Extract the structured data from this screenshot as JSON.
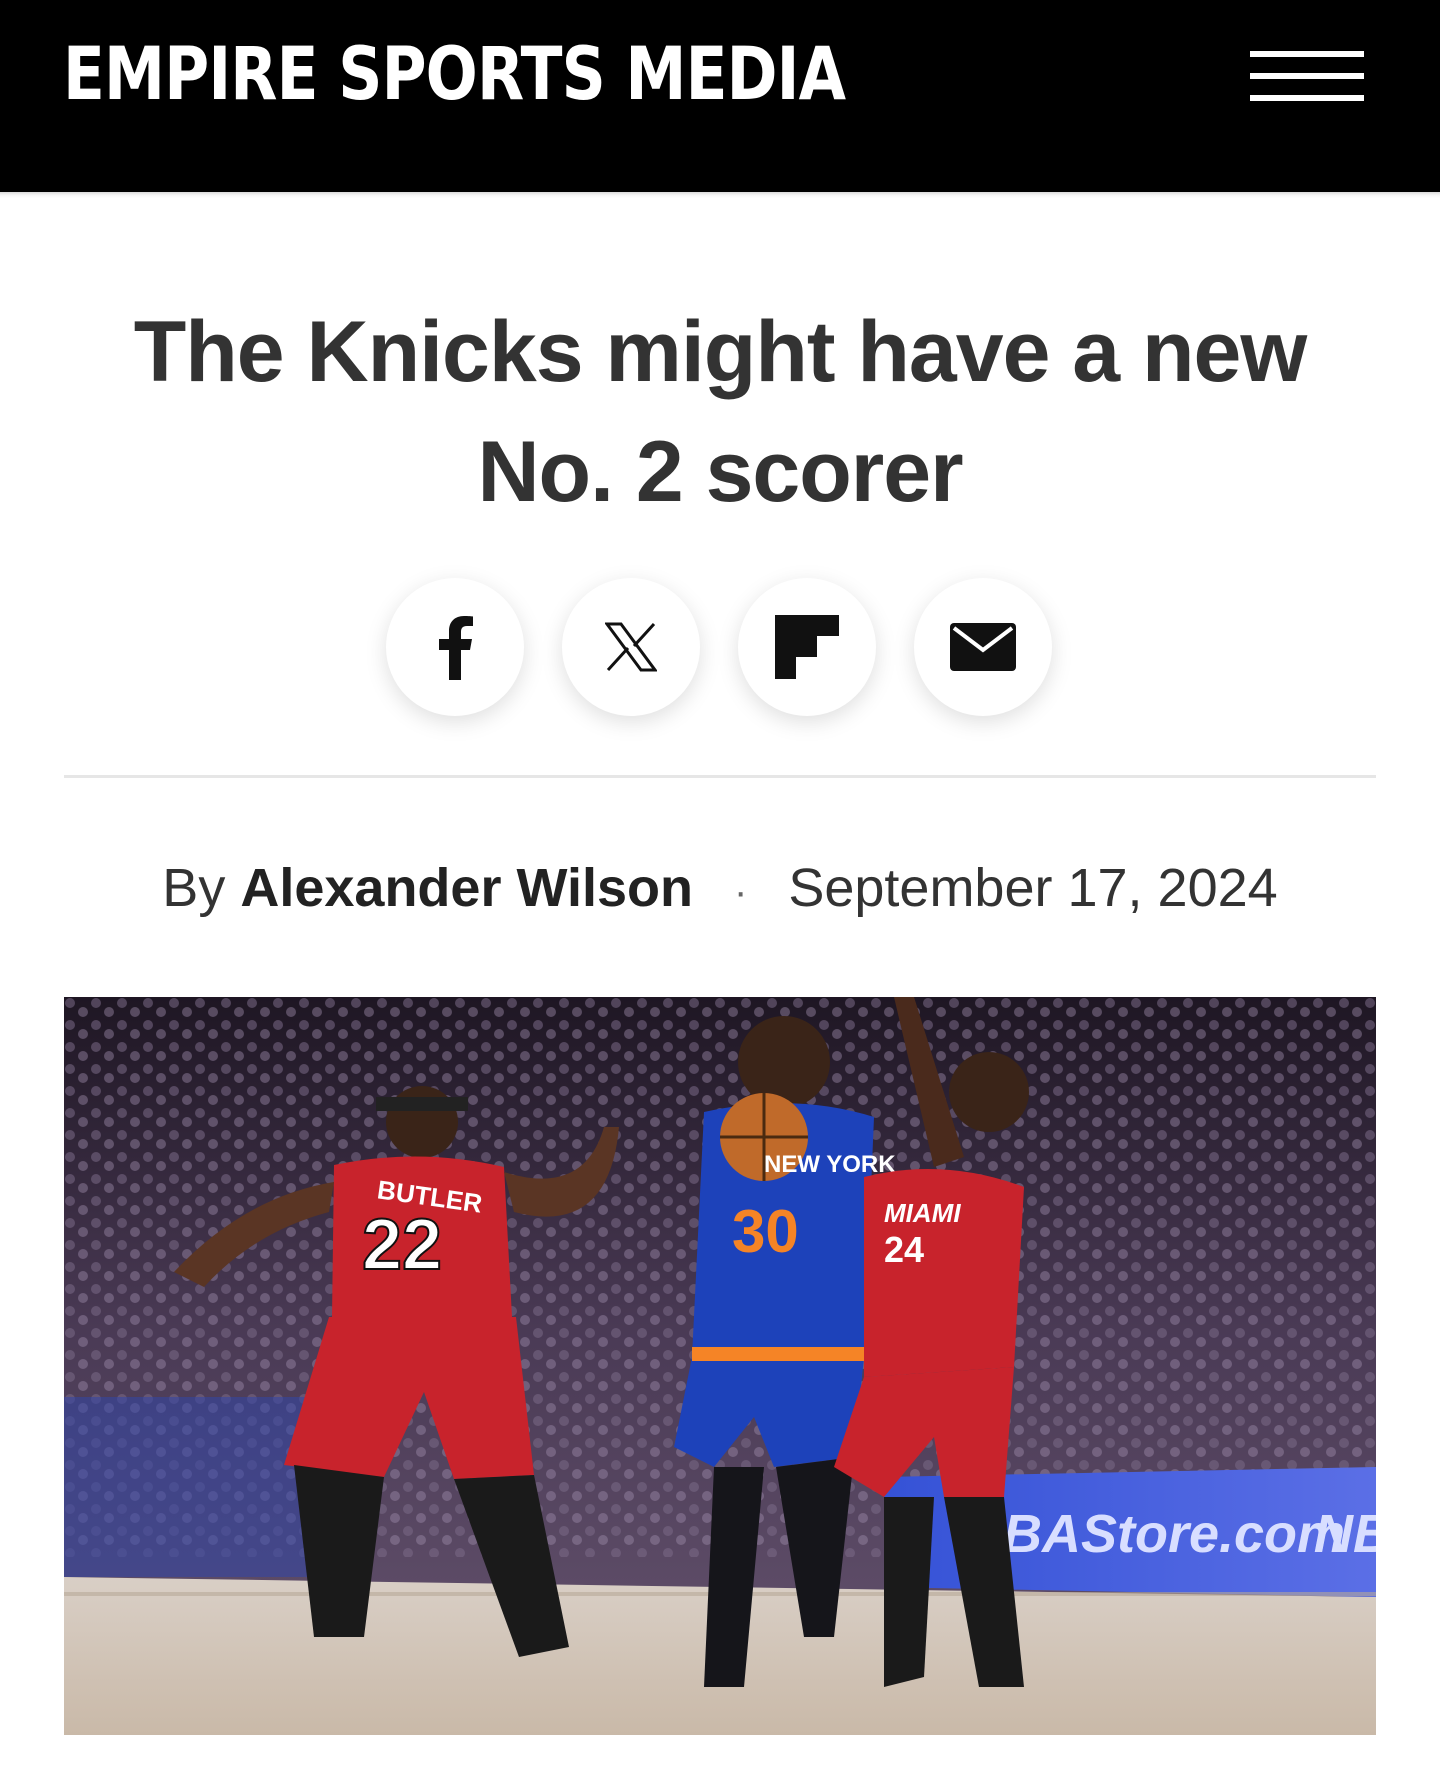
{
  "header": {
    "site_name": "EMPIRE SPORTS MEDIA",
    "menu_icon": "hamburger-menu-icon"
  },
  "article": {
    "headline": "The Knicks might have a new No. 2 scorer",
    "byline_prefix": "By",
    "author": "Alexander Wilson",
    "separator": "·",
    "date": "September 17, 2024"
  },
  "share": {
    "icons": [
      "facebook-icon",
      "x-icon",
      "flipboard-icon",
      "email-icon"
    ]
  },
  "hero_image": {
    "jersey_left_name": "BUTLER",
    "jersey_left_number": "22",
    "jersey_center_text": "NEW YORK",
    "jersey_center_number": "30",
    "jersey_right_text": "MIAMI",
    "jersey_right_number": "24",
    "board_text": "NBAStore.com",
    "board_text_2": "NBA"
  },
  "colors": {
    "header_bg": "#000000",
    "headline": "#333333",
    "heat_red": "#c8232c",
    "knicks_blue": "#1d42ba",
    "knicks_orange": "#f58426"
  }
}
